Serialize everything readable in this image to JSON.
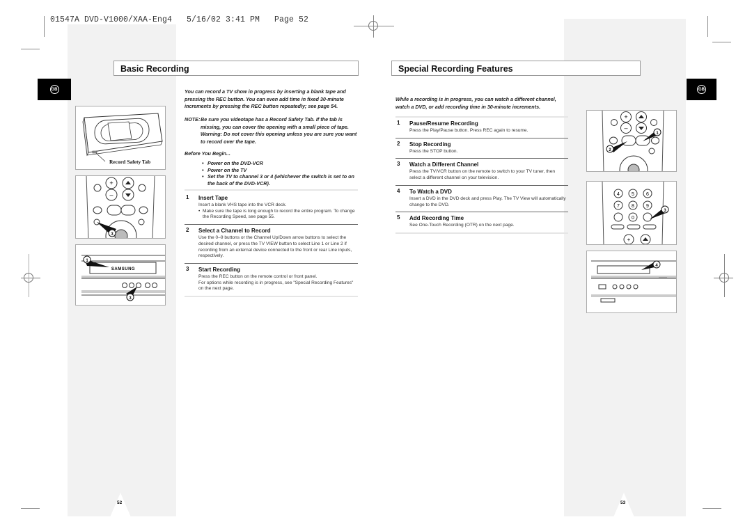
{
  "slug": "01547A DVD-V1000/XAA-Eng4   5/16/02 3:41 PM   Page 52",
  "left_page": {
    "badge": "GB",
    "title": "Basic Recording",
    "intro": "You can record a TV show in progress by inserting a blank tape and pressing the REC button. You can even add time in fixed 30-minute increments by pressing the REC button repeatedly; see page 54.",
    "note": {
      "label": "NOTE:",
      "text": "Be sure you videotape has a Record Safety Tab. If the tab is missing, you can cover the opening with a small piece of tape. Warning: Do not cover this opening unless you are sure you want to record over the tape."
    },
    "before_heading": "Before You Begin...",
    "before_items": [
      "Power on the DVD-VCR",
      "Power on the TV",
      "Set the TV to channel 3 or 4 (whichever the switch is set to on the back of the DVD-VCR)."
    ],
    "steps": [
      {
        "num": "1",
        "title": "Insert Tape",
        "body": "Insert a blank VHS tape into the VCR deck.",
        "bullet": "Make sure the tape is long enough to record the entire program. To change the Recording Speed, see page 55."
      },
      {
        "num": "2",
        "title": "Select a Channel to Record",
        "body": "Use the 0–9 buttons or the Channel Up/Down arrow buttons to select the desired channel, or press the TV VIEW button to select Line 1 or Line 2 if recording from an external device connected to the front or rear Line inputs, respectively."
      },
      {
        "num": "3",
        "title": "Start Recording",
        "body": "Press the REC button on the remote control or front panel.",
        "body2": "For options while recording is in progress, see \"Special Recording Features\" on the next page."
      }
    ],
    "illustrations": {
      "cassette_caption": "Record Safety Tab",
      "remote_callout": "3",
      "deck_callouts": [
        "1",
        "3"
      ],
      "deck_brand": "SAMSUNG"
    },
    "page_number": "52"
  },
  "right_page": {
    "badge": "GB",
    "title": "Special Recording Features",
    "intro": "While a recording is in progress, you can watch a different channel, watch a DVD, or add recording time in 30-minute increments.",
    "steps": [
      {
        "num": "1",
        "title": "Pause/Resume Recording",
        "body": "Press the Play/Pause button. Press REC again to resume."
      },
      {
        "num": "2",
        "title": "Stop Recording",
        "body": "Press the STOP button."
      },
      {
        "num": "3",
        "title": "Watch a Different Channel",
        "body": "Press the TV/VCR button on the remote to switch to your TV tuner, then select a different channel on your television."
      },
      {
        "num": "4",
        "title": "To Watch a DVD",
        "body": "Insert a DVD in the DVD deck and press Play. The TV View will automatically change to the DVD."
      },
      {
        "num": "5",
        "title": "Add Recording Time",
        "body": "See One-Touch Recording (OTR) on the next page."
      }
    ],
    "illustrations": {
      "remote1_callouts": [
        "1",
        "2"
      ],
      "remote2_callout": "3",
      "deck_callout": "4"
    },
    "page_number": "53"
  }
}
